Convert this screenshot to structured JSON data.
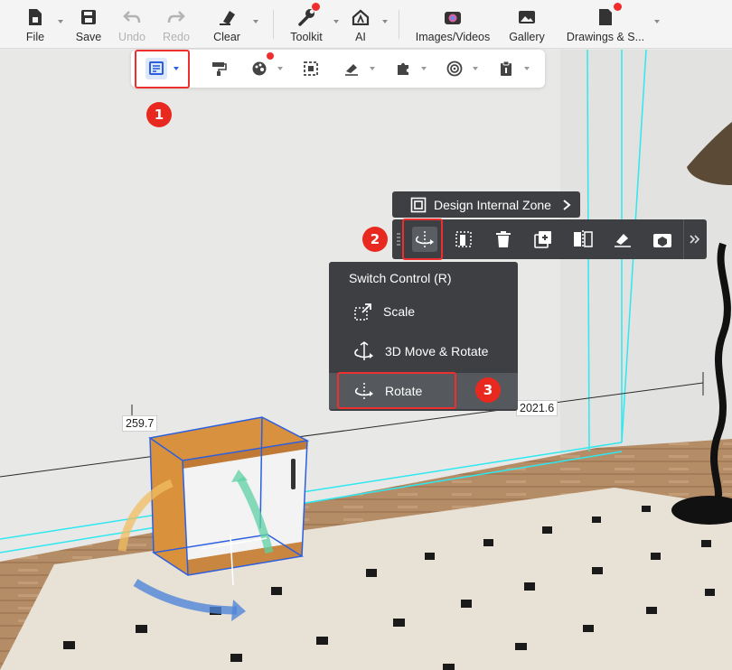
{
  "toolbar": {
    "file": "File",
    "save": "Save",
    "undo": "Undo",
    "redo": "Redo",
    "clear": "Clear",
    "toolkit": "Toolkit",
    "ai": "AI",
    "images_videos": "Images/Videos",
    "gallery": "Gallery",
    "drawings": "Drawings & S..."
  },
  "object_toolbar": {
    "design_internal_zone": "Design Internal Zone"
  },
  "switch_menu": {
    "title": "Switch Control (R)",
    "items": [
      "Scale",
      "3D Move & Rotate",
      "Rotate"
    ]
  },
  "dimensions": {
    "left": "259.7",
    "right": "2021.6"
  },
  "badges": [
    "1",
    "2",
    "3"
  ],
  "colors": {
    "highlight": "#ee2f2f",
    "badge": "#e8291f",
    "panel": "#3d3f42",
    "selection": "#2c5fe0",
    "wall_outline": "#2ee8f0"
  }
}
